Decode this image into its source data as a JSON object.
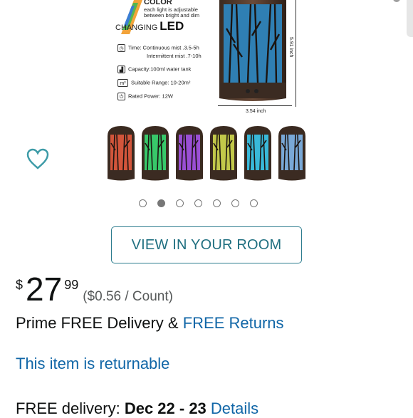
{
  "image_text": {
    "color_word": "COLOR",
    "adjust_note_1": "each light is adjustable",
    "adjust_note_2": "between bright and dim",
    "changing": "CHANGING",
    "led": "LED",
    "time_1": "Time: Continuous mist .3.5-5h",
    "time_2": "Intermittent mist .7-10h",
    "capacity": "Capacity:100ml water tank",
    "range": "Suitable Range: 10-20m²",
    "power": "Rated Power: 12W",
    "height_dim": "5.91 inch",
    "width_dim": "3.54 inch"
  },
  "carousel": {
    "total": 7,
    "active_index": 1
  },
  "view_room_label": "VIEW IN YOUR ROOM",
  "price": {
    "currency": "$",
    "whole": "27",
    "fraction": "99",
    "unit_price": "($0.56 / Count)"
  },
  "prime": {
    "text": "Prime FREE Delivery & ",
    "returns_link": "FREE Returns"
  },
  "returnable": "This item is returnable",
  "delivery": {
    "prefix": "FREE delivery: ",
    "dates": "Dec 22 - 23",
    "details_link": "Details"
  },
  "colors": {
    "link": "#1066a7",
    "button_border": "#2c7c8e",
    "diffuser_glows": [
      "#d2553b",
      "#38c86a",
      "#9a4fd4",
      "#c2c84a",
      "#39b9d9",
      "#79a8d6"
    ]
  }
}
